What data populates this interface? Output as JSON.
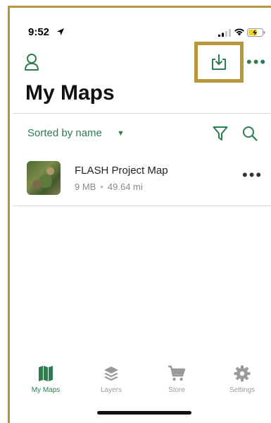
{
  "status_bar": {
    "time": "9:52"
  },
  "header": {
    "title": "My Maps"
  },
  "sort": {
    "label": "Sorted by name"
  },
  "maps": [
    {
      "name": "FLASH Project Map",
      "size": "9 MB",
      "distance": "49.64 mi"
    }
  ],
  "tabs": [
    {
      "label": "My Maps",
      "icon": "map-icon",
      "active": true
    },
    {
      "label": "Layers",
      "icon": "layers-icon",
      "active": false
    },
    {
      "label": "Store",
      "icon": "cart-icon",
      "active": false
    },
    {
      "label": "Settings",
      "icon": "gear-icon",
      "active": false
    }
  ],
  "colors": {
    "accent": "#2e7d4f",
    "highlight": "#b8963a",
    "inactive": "#9a9a9a"
  }
}
